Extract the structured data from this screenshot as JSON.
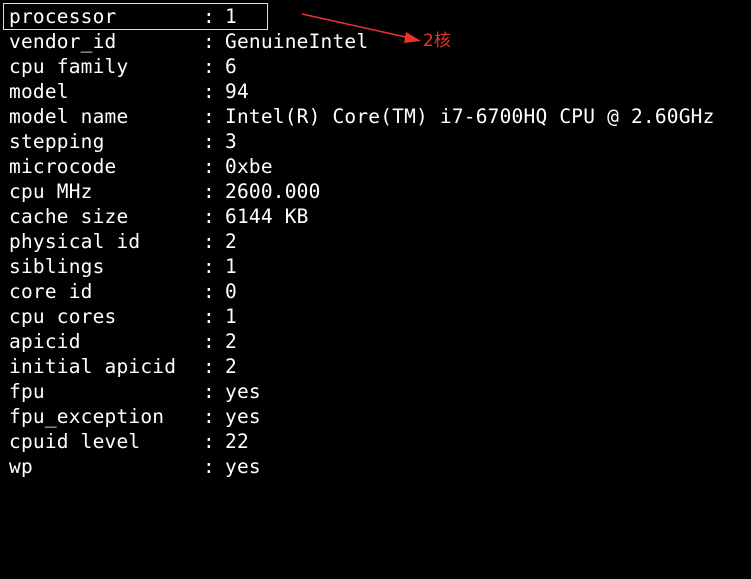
{
  "colors": {
    "background": "#000000",
    "text": "#ffffff",
    "highlight_box": "#f2e57a",
    "annotation": "#e8352c"
  },
  "separator": ":",
  "cpuinfo": [
    {
      "key": "processor",
      "value": "1"
    },
    {
      "key": "vendor_id",
      "value": "GenuineIntel"
    },
    {
      "key": "cpu family",
      "value": "6"
    },
    {
      "key": "model",
      "value": "94"
    },
    {
      "key": "model name",
      "value": "Intel(R) Core(TM) i7-6700HQ CPU @ 2.60GHz"
    },
    {
      "key": "stepping",
      "value": "3"
    },
    {
      "key": "microcode",
      "value": "0xbe"
    },
    {
      "key": "cpu MHz",
      "value": "2600.000"
    },
    {
      "key": "cache size",
      "value": "6144 KB"
    },
    {
      "key": "physical id",
      "value": "2"
    },
    {
      "key": "siblings",
      "value": "1"
    },
    {
      "key": "core id",
      "value": "0"
    },
    {
      "key": "cpu cores",
      "value": "1"
    },
    {
      "key": "apicid",
      "value": "2"
    },
    {
      "key": "initial apicid",
      "value": "2"
    },
    {
      "key": "fpu",
      "value": "yes"
    },
    {
      "key": "fpu_exception",
      "value": "yes"
    },
    {
      "key": "cpuid level",
      "value": "22"
    },
    {
      "key": "wp",
      "value": "yes"
    }
  ],
  "annotation": {
    "text": "2核"
  }
}
